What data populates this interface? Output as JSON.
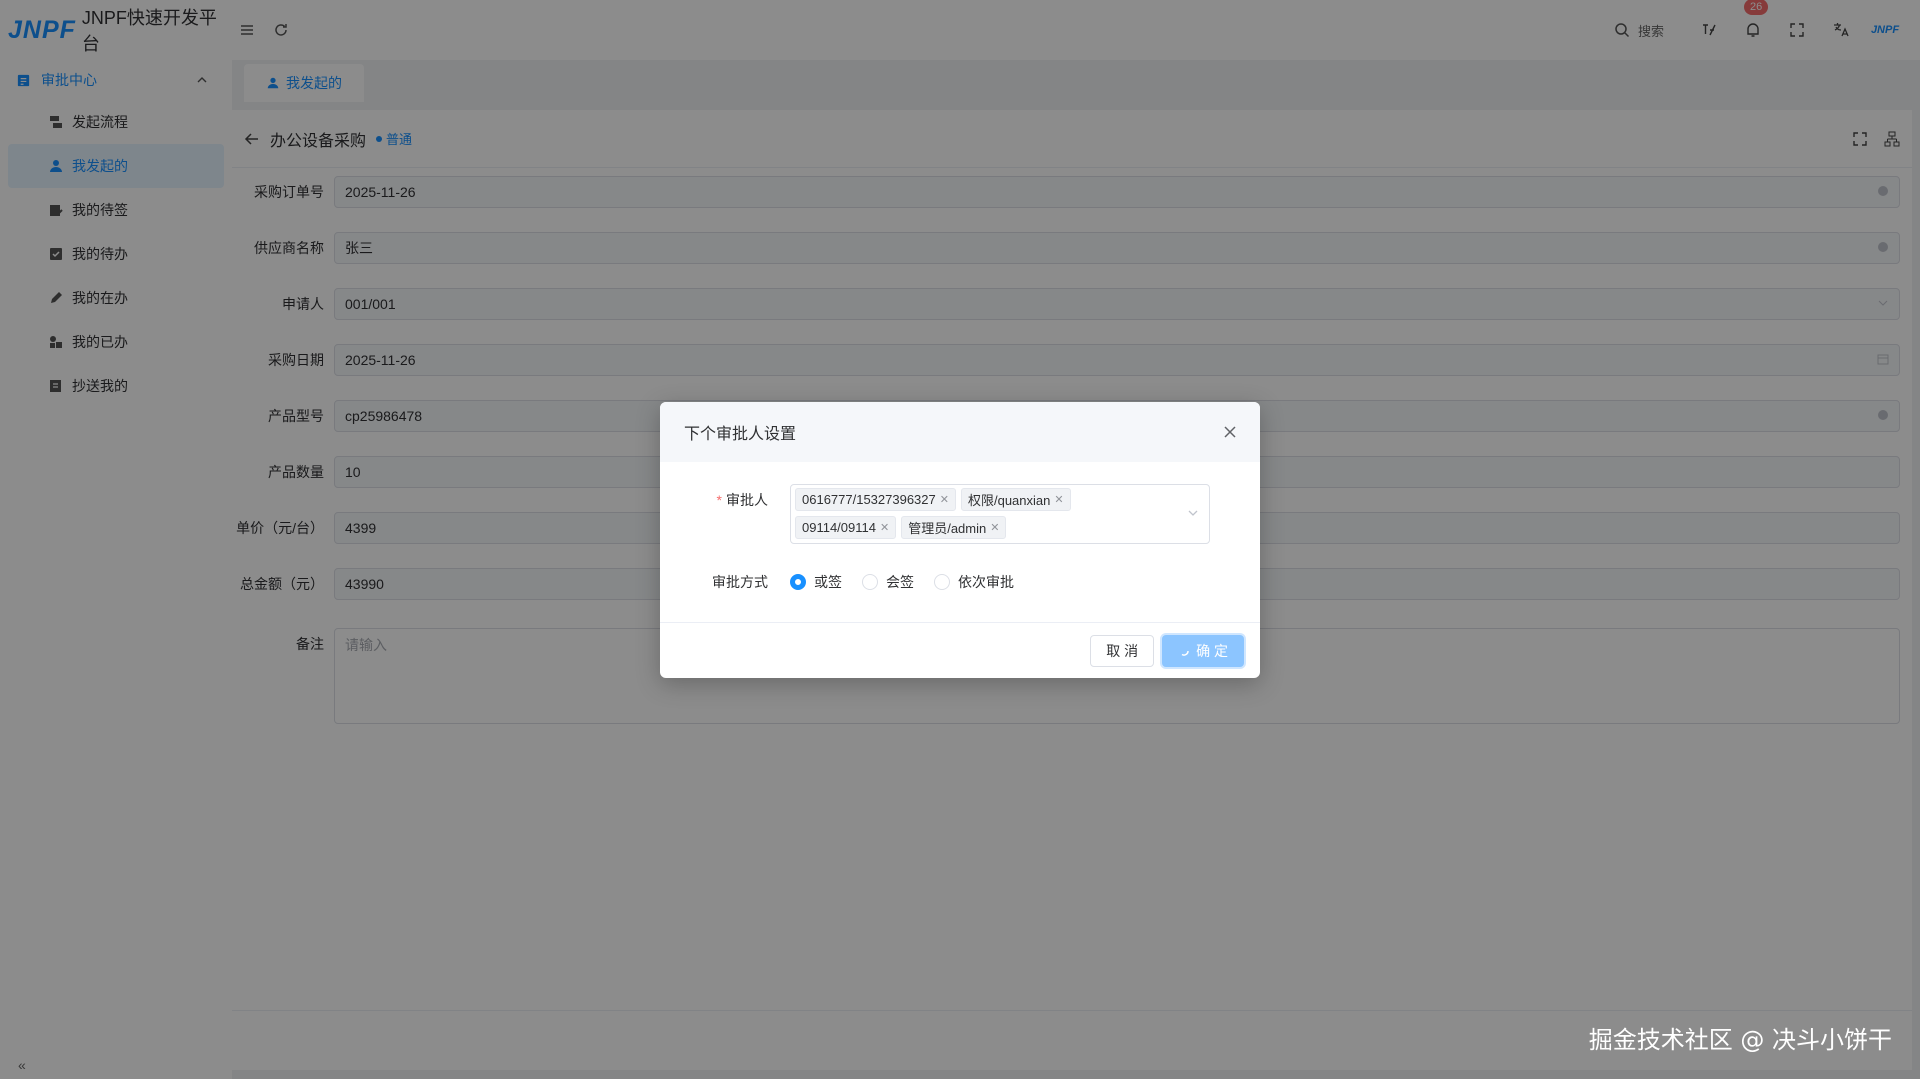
{
  "header": {
    "logo_text": "JNPF",
    "app_title": "JNPF快速开发平台",
    "search_label": "搜索",
    "notification_count": "26",
    "avatar_text": "JNPF"
  },
  "sidebar": {
    "group_label": "审批中心",
    "items": [
      {
        "label": "发起流程"
      },
      {
        "label": "我发起的"
      },
      {
        "label": "我的待签"
      },
      {
        "label": "我的待办"
      },
      {
        "label": "我的在办"
      },
      {
        "label": "我的已办"
      },
      {
        "label": "抄送我的"
      }
    ],
    "collapse_symbol": "«"
  },
  "tabs": [
    {
      "label": "我发起的"
    }
  ],
  "panel": {
    "title": "办公设备采购",
    "tag": "普通"
  },
  "form": {
    "fields": [
      {
        "label": "采购订单号",
        "value": "2025-11-26"
      },
      {
        "label": "供应商名称",
        "value": "张三"
      },
      {
        "label": "申请人",
        "value": "001/001"
      },
      {
        "label": "采购日期",
        "value": "2025-11-26"
      },
      {
        "label": "产品型号",
        "value": "cp25986478"
      },
      {
        "label": "产品数量",
        "value": "10"
      },
      {
        "label": "单价（元/台）",
        "value": "4399"
      },
      {
        "label": "总金额（元）",
        "value": "43990"
      }
    ],
    "remark_label": "备注",
    "remark_placeholder": "请输入"
  },
  "dialog": {
    "title": "下个审批人设置",
    "approver_label": "审批人",
    "approvers": [
      {
        "label": "0616777/15327396327"
      },
      {
        "label": "权限/quanxian"
      },
      {
        "label": "09114/09114"
      },
      {
        "label": "管理员/admin"
      }
    ],
    "method_label": "审批方式",
    "methods": [
      {
        "label": "或签"
      },
      {
        "label": "会签"
      },
      {
        "label": "依次审批"
      }
    ],
    "cancel_label": "取 消",
    "confirm_label": "确 定"
  },
  "watermark": "掘金技术社区 @ 决斗小饼干",
  "colors": {
    "accent": "#1890ff",
    "danger": "#f56c6c"
  }
}
